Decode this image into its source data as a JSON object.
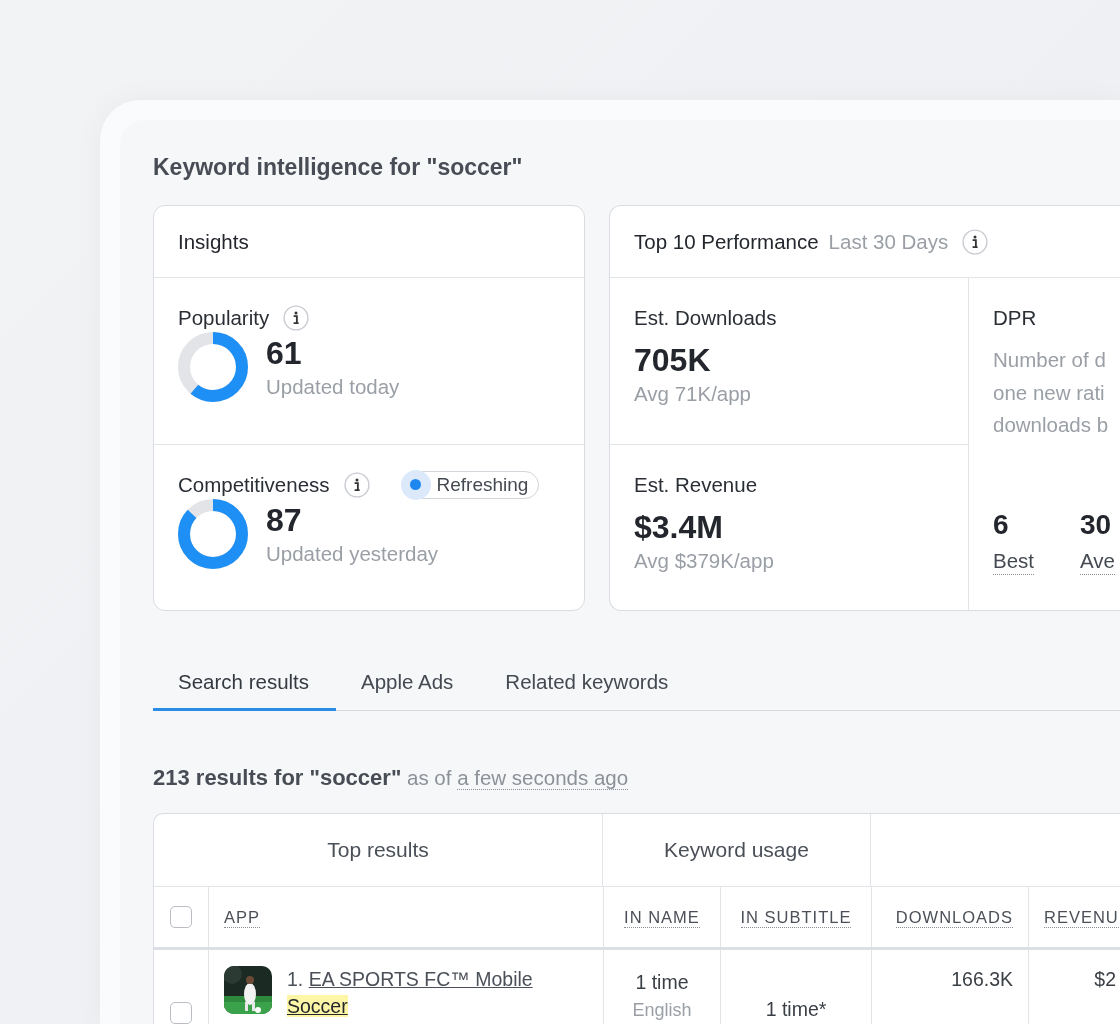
{
  "title": "Keyword intelligence for \"soccer\"",
  "insights": {
    "title": "Insights",
    "metrics": [
      {
        "label": "Popularity",
        "level": 0.61,
        "value": "61",
        "updated": "Updated today"
      },
      {
        "label": "Competitiveness",
        "level": 0.87,
        "value": "87",
        "updated": "Updated yesterday",
        "badge": "Refreshing"
      }
    ]
  },
  "performance": {
    "title": "Top 10 Performance",
    "period": "Last 30 Days",
    "stats": [
      {
        "label": "Est. Downloads",
        "value": "705K",
        "sub": "Avg 71K/app"
      },
      {
        "label": "Est. Revenue",
        "value": "$3.4M",
        "sub": "Avg $379K/app"
      }
    ],
    "dpr": {
      "label": "DPR",
      "description": "Number of d\none new rati\ndownloads b",
      "stats": [
        {
          "value": "6",
          "label": "Best"
        },
        {
          "value": "30",
          "label": "Ave"
        }
      ]
    }
  },
  "tabs": [
    {
      "label": "Search results",
      "selected": true
    },
    {
      "label": "Apple Ads",
      "selected": false
    },
    {
      "label": "Related keywords",
      "selected": false
    }
  ],
  "results": {
    "summary": "**213 results for \"soccer\"** as of",
    "time": "a few seconds ago"
  },
  "table": {
    "groups": [
      "Top results",
      "Keyword usage"
    ],
    "select_all_checked": false,
    "columns": [
      "APP",
      "IN NAME",
      "IN SUBTITLE",
      "DOWNLOADS",
      "REVENU"
    ],
    "rows": [
      {
        "checked": false,
        "rank": "1.",
        "name": [
          {
            "text": "EA SPORTS FC™ Mobile",
            "highlight": false
          },
          {
            "text": "Soccer",
            "highlight": true
          }
        ],
        "in_name": {
          "count": "1 time",
          "language": "English"
        },
        "in_subtitle": {
          "count": "1 time*"
        },
        "downloads": "166.3K",
        "revenue": "$2"
      }
    ]
  }
}
